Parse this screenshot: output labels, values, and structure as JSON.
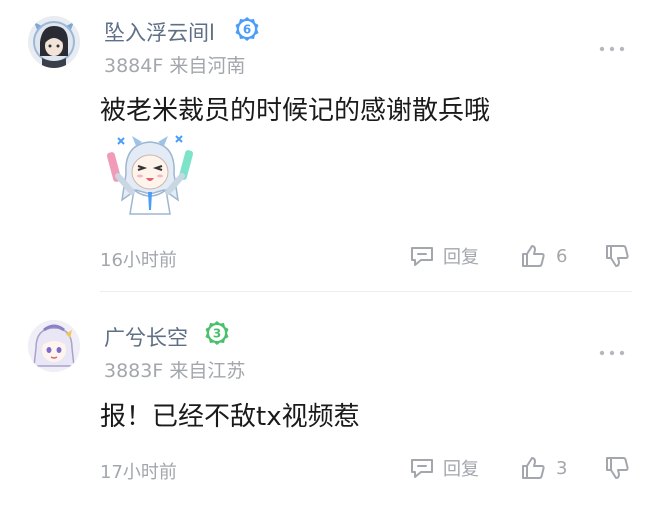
{
  "comments": [
    {
      "username": "坠入浮云间l",
      "level": "6",
      "level_color": "#4a9df8",
      "meta": "3884F 来自河南",
      "content": "被老米裁员的时候记的感谢散兵哦",
      "sticker": "chibi-girl-sticker",
      "time": "16小时前",
      "reply_label": "回复",
      "likes": "6"
    },
    {
      "username": "广兮长空",
      "level": "3",
      "level_color": "#49c06b",
      "meta": "3883F 来自江苏",
      "content": "报！已经不敌tx视频惹",
      "time": "17小时前",
      "reply_label": "回复",
      "likes": "3"
    }
  ],
  "icons": {
    "more": "more-dots-icon",
    "reply": "reply-bubble-icon",
    "like": "thumbs-up-icon",
    "dislike": "thumbs-down-icon"
  }
}
